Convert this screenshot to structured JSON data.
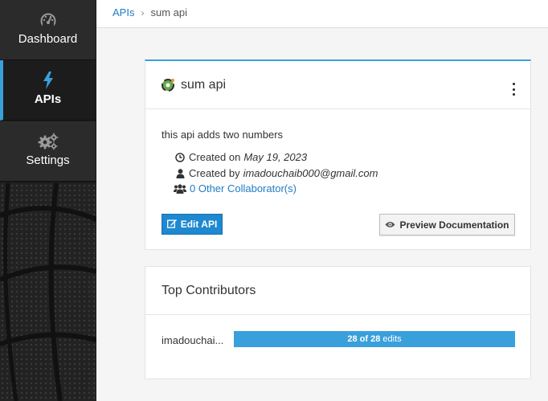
{
  "sidebar": {
    "items": [
      {
        "label": "Dashboard",
        "icon": "dashboard-icon",
        "active": false
      },
      {
        "label": "APIs",
        "icon": "bolt-icon",
        "active": true
      },
      {
        "label": "Settings",
        "icon": "gears-icon",
        "active": false
      }
    ]
  },
  "breadcrumb": {
    "parent": "APIs",
    "separator": "›",
    "current": "sum api"
  },
  "api": {
    "title": "sum api",
    "description": "this api adds two numbers",
    "created_on_label": "Created on",
    "created_on": "May 19, 2023",
    "created_by_label": "Created by",
    "created_by": "imadouchaib000@gmail.com",
    "collaborators": "0 Other Collaborator(s)",
    "edit_label": "Edit API",
    "preview_label": "Preview Documentation"
  },
  "contributors": {
    "title": "Top Contributors",
    "rows": [
      {
        "name": "imadouchai...",
        "edits_count": "28 of 28",
        "edits_suffix": "edits",
        "fraction": 1.0
      }
    ]
  },
  "colors": {
    "accent": "#39a0dc",
    "link": "#1e7cc4",
    "button_primary": "#1e88d0",
    "sidebar_bg": "#1b1b1b"
  }
}
